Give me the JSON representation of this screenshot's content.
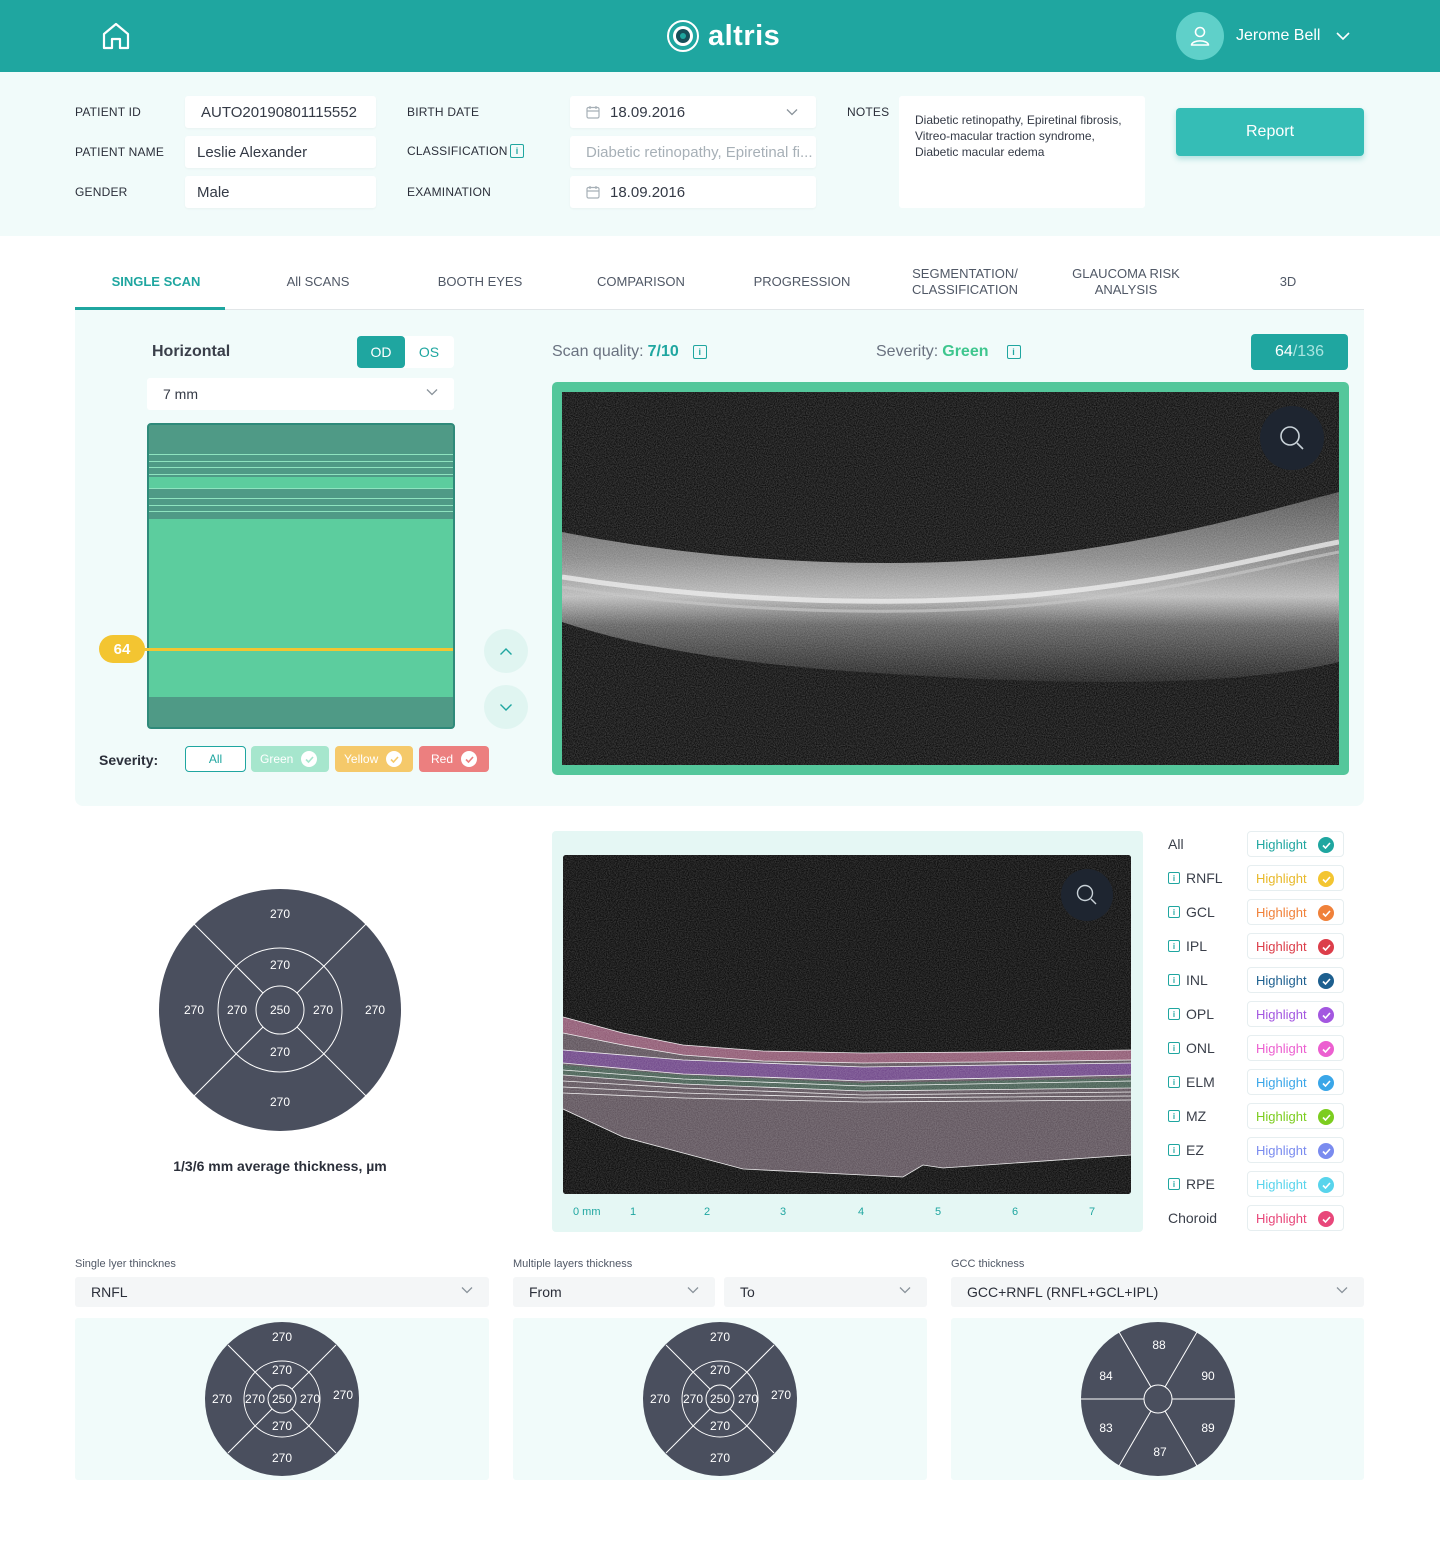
{
  "header": {
    "logo_text": "altris",
    "user_name": "Jerome Bell",
    "brand_color": "#1fa6a0"
  },
  "patient": {
    "id_label": "PATIENT ID",
    "id_value": "AUTO20190801115552",
    "name_label": "PATIENT NAME",
    "name_value": "Leslie Alexander",
    "gender_label": "GENDER",
    "gender_value": "Male",
    "birth_label": "BIRTH DATE",
    "birth_value": "18.09.2016",
    "class_label": "CLASSIFICATION",
    "class_placeholder": "Diabetic retinopathy, Epiretinal fi...",
    "exam_label": "EXAMINATION",
    "exam_value": "18.09.2016",
    "notes_label": "NOTES",
    "notes_value": "Diabetic retinopathy, Epiretinal fibrosis, Vitreo-macular traction syndrome, Diabetic macular edema",
    "report_label": "Report"
  },
  "tabs": [
    {
      "label": "SINGLE SCAN",
      "active": true
    },
    {
      "label": "All SCANS"
    },
    {
      "label": "BOOTH EYES"
    },
    {
      "label": "COMPARISON"
    },
    {
      "label": "PROGRESSION"
    },
    {
      "label": "SEGMENTATION/ CLASSIFICATION"
    },
    {
      "label": "GLAUCOMA RISK ANALYSIS"
    },
    {
      "label": "3D"
    }
  ],
  "scan": {
    "orientation": "Horizontal",
    "eye_od": "OD",
    "eye_os": "OS",
    "eye_selected": "OD",
    "mm_value": "7 mm",
    "current_slice": "64",
    "quality_label": "Scan quality:",
    "quality_value": "7/10",
    "severity_label": "Severity:",
    "severity_value": "Green",
    "count_current": "64",
    "count_total": "/136",
    "filter_label": "Severity:",
    "filters": {
      "all": "All",
      "green": "Green",
      "yellow": "Yellow",
      "red": "Red"
    },
    "filter_colors": {
      "green": "#a6e6cd",
      "yellow": "#f5c96a",
      "red": "#ec7f7f"
    }
  },
  "etdrs_main": {
    "values": {
      "outer_top": "270",
      "outer_left": "270",
      "outer_right": "270",
      "outer_bottom": "270",
      "inner_top": "270",
      "inner_left": "270",
      "inner_right": "270",
      "inner_bottom": "270",
      "center": "250"
    },
    "caption": "1/3/6 mm average thickness, µm"
  },
  "segmentation": {
    "mm_ticks": [
      "0 mm",
      "1",
      "2",
      "3",
      "4",
      "5",
      "6",
      "7"
    ],
    "highlight_label": "Highlight",
    "layers": [
      {
        "name": "All",
        "info": false,
        "color": "#1fa6a0",
        "text_color": "#1fa6a0"
      },
      {
        "name": "RNFL",
        "info": true,
        "color": "#f3c531",
        "text_color": "#e8b92a"
      },
      {
        "name": "GCL",
        "info": true,
        "color": "#f0813a",
        "text_color": "#f0813a"
      },
      {
        "name": "IPL",
        "info": true,
        "color": "#dc3e4a",
        "text_color": "#dc3e4a"
      },
      {
        "name": "INL",
        "info": true,
        "color": "#1d5f8f",
        "text_color": "#1d5f8f"
      },
      {
        "name": "OPL",
        "info": true,
        "color": "#a357e0",
        "text_color": "#a357e0"
      },
      {
        "name": "ONL",
        "info": true,
        "color": "#ec5fd0",
        "text_color": "#ec5fd0"
      },
      {
        "name": "ELM",
        "info": true,
        "color": "#3aa6e8",
        "text_color": "#3aa6e8"
      },
      {
        "name": "MZ",
        "info": true,
        "color": "#7ccd1f",
        "text_color": "#7ccd1f"
      },
      {
        "name": "EZ",
        "info": true,
        "color": "#7a8bef",
        "text_color": "#7a8bef"
      },
      {
        "name": "RPE",
        "info": true,
        "color": "#58d4ec",
        "text_color": "#58d4ec"
      },
      {
        "name": "Choroid",
        "info": false,
        "color": "#e8477a",
        "text_color": "#e8477a"
      }
    ]
  },
  "bottom": {
    "single_label": "Single lyer thincknes",
    "single_value": "RNFL",
    "multi_label": "Multiple layers thickness",
    "multi_from": "From",
    "multi_to": "To",
    "gcc_label": "GCC thickness",
    "gcc_value": "GCC+RNFL (RNFL+GCL+IPL)",
    "etdrs_single": {
      "outer_top": "270",
      "outer_left": "270",
      "outer_right": "270",
      "outer_bottom": "270",
      "inner_top": "270",
      "inner_left": "270",
      "inner_right": "270",
      "inner_bottom": "270",
      "center": "250"
    },
    "etdrs_multi": {
      "outer_top": "270",
      "outer_left": "270",
      "outer_right": "270",
      "outer_bottom": "270",
      "inner_top": "270",
      "inner_left": "270",
      "inner_right": "270",
      "inner_bottom": "270",
      "center": "250"
    },
    "gcc": {
      "top": "88",
      "top_right": "90",
      "bottom_right": "89",
      "bottom": "87",
      "bottom_left": "83",
      "top_left": "84"
    }
  }
}
